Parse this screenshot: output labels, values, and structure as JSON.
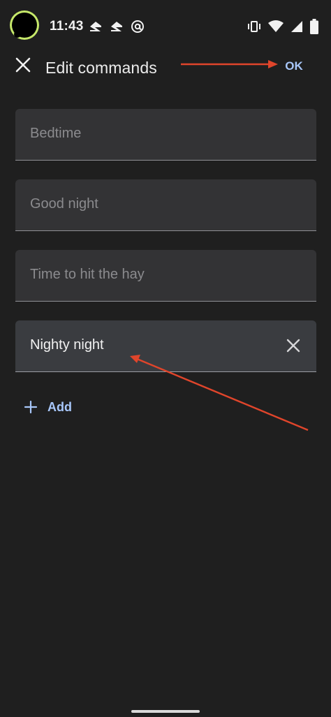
{
  "status_bar": {
    "time": "11:43",
    "notification_icons": [
      "zillow-icon",
      "zillow-icon",
      "at-icon"
    ],
    "system_icons": [
      "vibrate-icon",
      "wifi-icon",
      "signal-icon",
      "battery-icon"
    ]
  },
  "app_bar": {
    "title": "Edit commands",
    "ok_label": "OK",
    "close_icon": "close-icon"
  },
  "commands": [
    {
      "text": "Bedtime",
      "state": "placeholder"
    },
    {
      "text": "Good night",
      "state": "placeholder"
    },
    {
      "text": "Time to hit the hay",
      "state": "placeholder"
    },
    {
      "text": "Nighty night",
      "state": "active"
    }
  ],
  "add": {
    "label": "Add",
    "icon": "plus-icon"
  },
  "colors": {
    "background": "#1f1f1f",
    "field": "#333335",
    "field_active": "#3a3c40",
    "accent": "#a8c7fa",
    "annotation_arrow": "#e0452b"
  }
}
